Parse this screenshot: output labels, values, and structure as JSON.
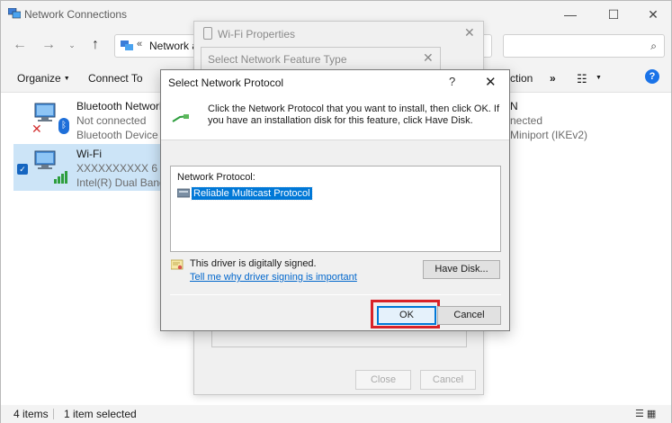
{
  "explorer": {
    "title": "Network Connections",
    "window_controls": {
      "minimize": "—",
      "maximize": "☐",
      "close": "✕"
    },
    "nav": {
      "back": "←",
      "forward": "→",
      "recent": "⌄",
      "up": "↑"
    },
    "address": {
      "chevron": "«",
      "text": "Network ar"
    },
    "search_icon": "⌕",
    "toolbar": {
      "organize_label": "Organize",
      "connect_label": "Connect To",
      "diagnose_partial": "ction",
      "more": "»",
      "view_icon": "☷",
      "help": "?"
    },
    "connections": [
      {
        "name": "Bluetooth Network C",
        "status": "Not connected",
        "device": "Bluetooth Device (Pe"
      },
      {
        "name": "Wi-Fi",
        "status": "XXXXXXXXXX 6",
        "device": "Intel(R) Dual Band W"
      }
    ],
    "right_connection": {
      "name": "N",
      "status": "nected",
      "device": "Miniport (IKEv2)"
    },
    "status": {
      "items": "4 items",
      "selected": "1 item selected",
      "view_icons": "☰ ▦"
    }
  },
  "wifi_properties": {
    "title": "Wi-Fi Properties",
    "close_label": "Close",
    "cancel_label": "Cancel"
  },
  "feature_type": {
    "title": "Select Network Feature Type"
  },
  "dialog": {
    "title": "Select Network Protocol",
    "help": "?",
    "close": "✕",
    "instruction": "Click the Network Protocol that you want to install, then click OK. If you have an installation disk for this feature, click Have Disk.",
    "list_header": "Network Protocol:",
    "protocols": [
      "Reliable Multicast Protocol"
    ],
    "signed_text": "This driver is digitally signed.",
    "signing_link": "Tell me why driver signing is important",
    "have_disk_label": "Have Disk...",
    "ok_label": "OK",
    "cancel_label": "Cancel"
  },
  "colors": {
    "highlight": "#d92228",
    "selection": "#0078d7",
    "accent": "#1a73e8"
  }
}
